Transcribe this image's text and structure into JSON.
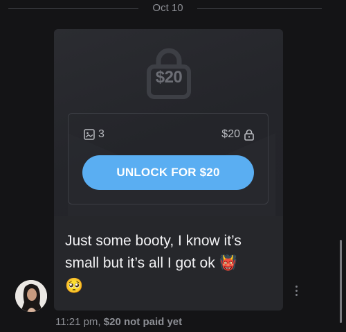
{
  "date_divider": {
    "label": "Oct 10"
  },
  "locked_media": {
    "lock_price": "$20",
    "media_count": "3",
    "price": "$20",
    "unlock_button_label": "UNLOCK FOR $20"
  },
  "message": {
    "text_line1": "Just some booty, I know it’s",
    "text_line2": "small but it’s all I got ok",
    "emoji_1": "👹",
    "emoji_2": "🥺"
  },
  "meta": {
    "time": "11:21 pm,",
    "status": "$20 not paid yet"
  },
  "colors": {
    "background": "#141416",
    "card": "#26272b",
    "accent": "#5aaef2",
    "muted_text": "#8c8e94"
  },
  "icons": {
    "lock": "lock-icon",
    "media": "image-icon",
    "small_lock": "lock-icon",
    "options": "more-vertical-icon"
  }
}
